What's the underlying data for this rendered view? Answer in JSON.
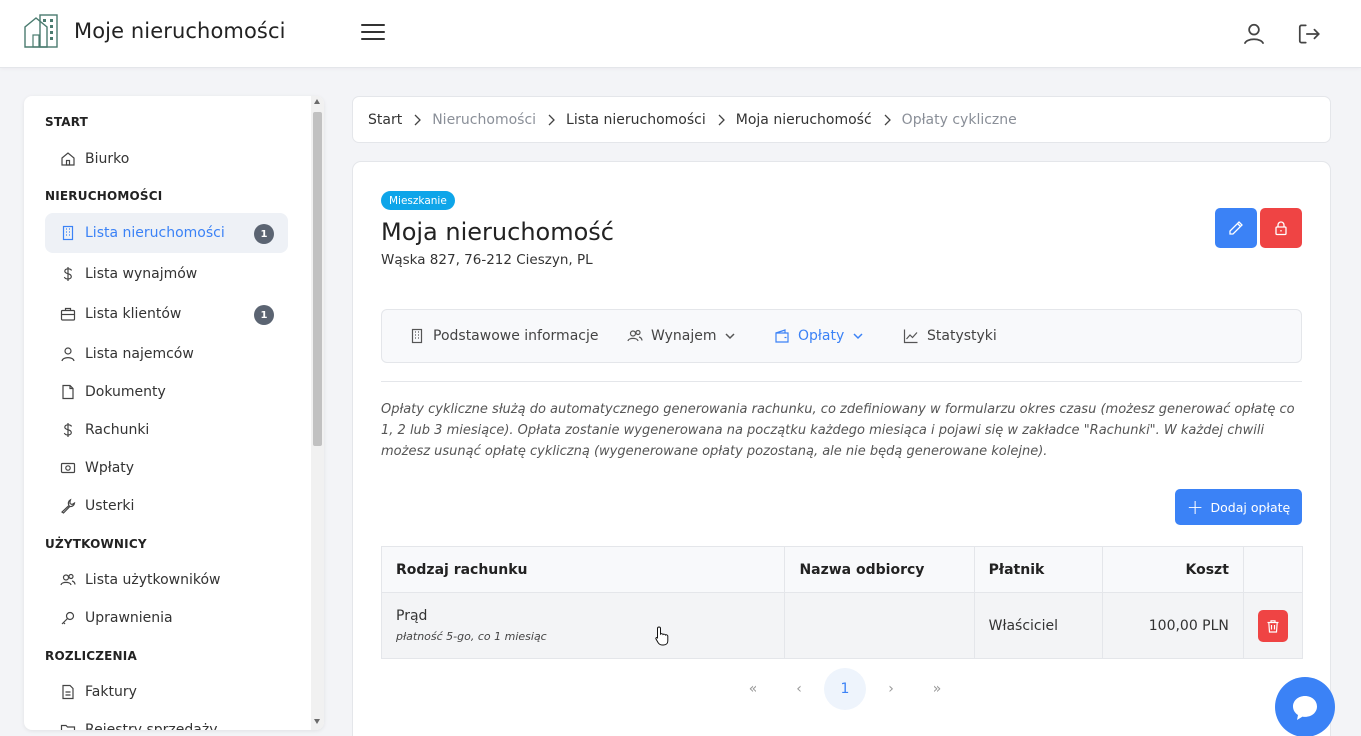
{
  "app": {
    "title": "Moje nieruchomości"
  },
  "sidebar": {
    "sections": [
      {
        "title": "START"
      },
      {
        "title": "NIERUCHOMOŚCI"
      },
      {
        "title": "UŻYTKOWNICY"
      },
      {
        "title": "ROZLICZENIA"
      }
    ],
    "items": [
      {
        "label": "Biurko",
        "icon": "home-icon"
      },
      {
        "label": "Lista nieruchomości",
        "icon": "building-icon",
        "badge": "1",
        "active": true
      },
      {
        "label": "Lista wynajmów",
        "icon": "dollar-icon"
      },
      {
        "label": "Lista klientów",
        "icon": "briefcase-icon",
        "badge": "1"
      },
      {
        "label": "Lista najemców",
        "icon": "user-icon"
      },
      {
        "label": "Dokumenty",
        "icon": "file-icon"
      },
      {
        "label": "Rachunki",
        "icon": "dollar-icon"
      },
      {
        "label": "Wpłaty",
        "icon": "cash-icon"
      },
      {
        "label": "Usterki",
        "icon": "wrench-icon"
      },
      {
        "label": "Lista użytkowników",
        "icon": "users-icon"
      },
      {
        "label": "Uprawnienia",
        "icon": "key-icon"
      },
      {
        "label": "Faktury",
        "icon": "invoice-icon"
      },
      {
        "label": "Rejestry sprzedaży",
        "icon": "folder-icon"
      }
    ]
  },
  "breadcrumb": [
    "Start",
    "Nieruchomości",
    "Lista nieruchomości",
    "Moja nieruchomość",
    "Opłaty cykliczne"
  ],
  "property": {
    "type": "Mieszkanie",
    "name": "Moja nieruchomość",
    "address": "Wąska 827, 76-212 Cieszyn, PL"
  },
  "tabs": [
    {
      "label": "Podstawowe informacje"
    },
    {
      "label": "Wynajem"
    },
    {
      "label": "Opłaty",
      "active": true
    },
    {
      "label": "Statystyki"
    }
  ],
  "info_text": "Opłaty cykliczne służą do automatycznego generowania rachunku, co zdefiniowany w formularzu okres czasu (możesz generować opłatę co 1, 2 lub 3 miesiące). Opłata zostanie wygenerowana na początku każdego miesiąca i pojawi się w zakładce \"Rachunki\". W każdej chwili możesz usunąć opłatę cykliczną (wygenerowane opłaty pozostaną, ale nie będą generowane kolejne).",
  "add_button": "Dodaj opłatę",
  "table": {
    "headers": [
      "Rodzaj rachunku",
      "Nazwa odbiorcy",
      "Płatnik",
      "Koszt"
    ],
    "rows": [
      {
        "type": "Prąd",
        "details": "płatność 5-go, co 1 miesiąc",
        "recipient": "",
        "payer": "Właściciel",
        "cost": "100,00 PLN"
      }
    ]
  },
  "pagination": {
    "first": "«",
    "prev": "‹",
    "current": "1",
    "next": "›",
    "last": "»"
  },
  "colors": {
    "primary": "#3b82f6",
    "danger": "#ef4444",
    "badge": "#0ea5e9"
  }
}
